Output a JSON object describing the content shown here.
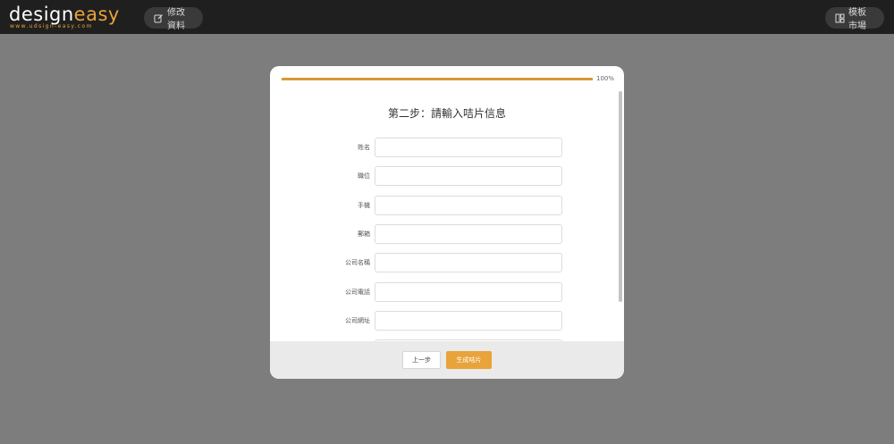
{
  "header": {
    "logo": {
      "part1": "design",
      "part2": "easy",
      "tagline": "www.udsign-easy.com"
    },
    "edit_profile_label": "修改資料",
    "template_market_label": "模板市場"
  },
  "modal": {
    "progress": {
      "fraction": 1.0,
      "label": "100%"
    },
    "title": "第二步：請輸入咭片信息",
    "fields": [
      {
        "label": "姓名",
        "value": ""
      },
      {
        "label": "職位",
        "value": ""
      },
      {
        "label": "手機",
        "value": ""
      },
      {
        "label": "郵箱",
        "value": ""
      },
      {
        "label": "公司名稱",
        "value": ""
      },
      {
        "label": "公司電話",
        "value": ""
      },
      {
        "label": "公司網址",
        "value": ""
      },
      {
        "label": "",
        "value": ""
      }
    ],
    "prev_button": "上一步",
    "generate_button": "生成咭片"
  }
}
